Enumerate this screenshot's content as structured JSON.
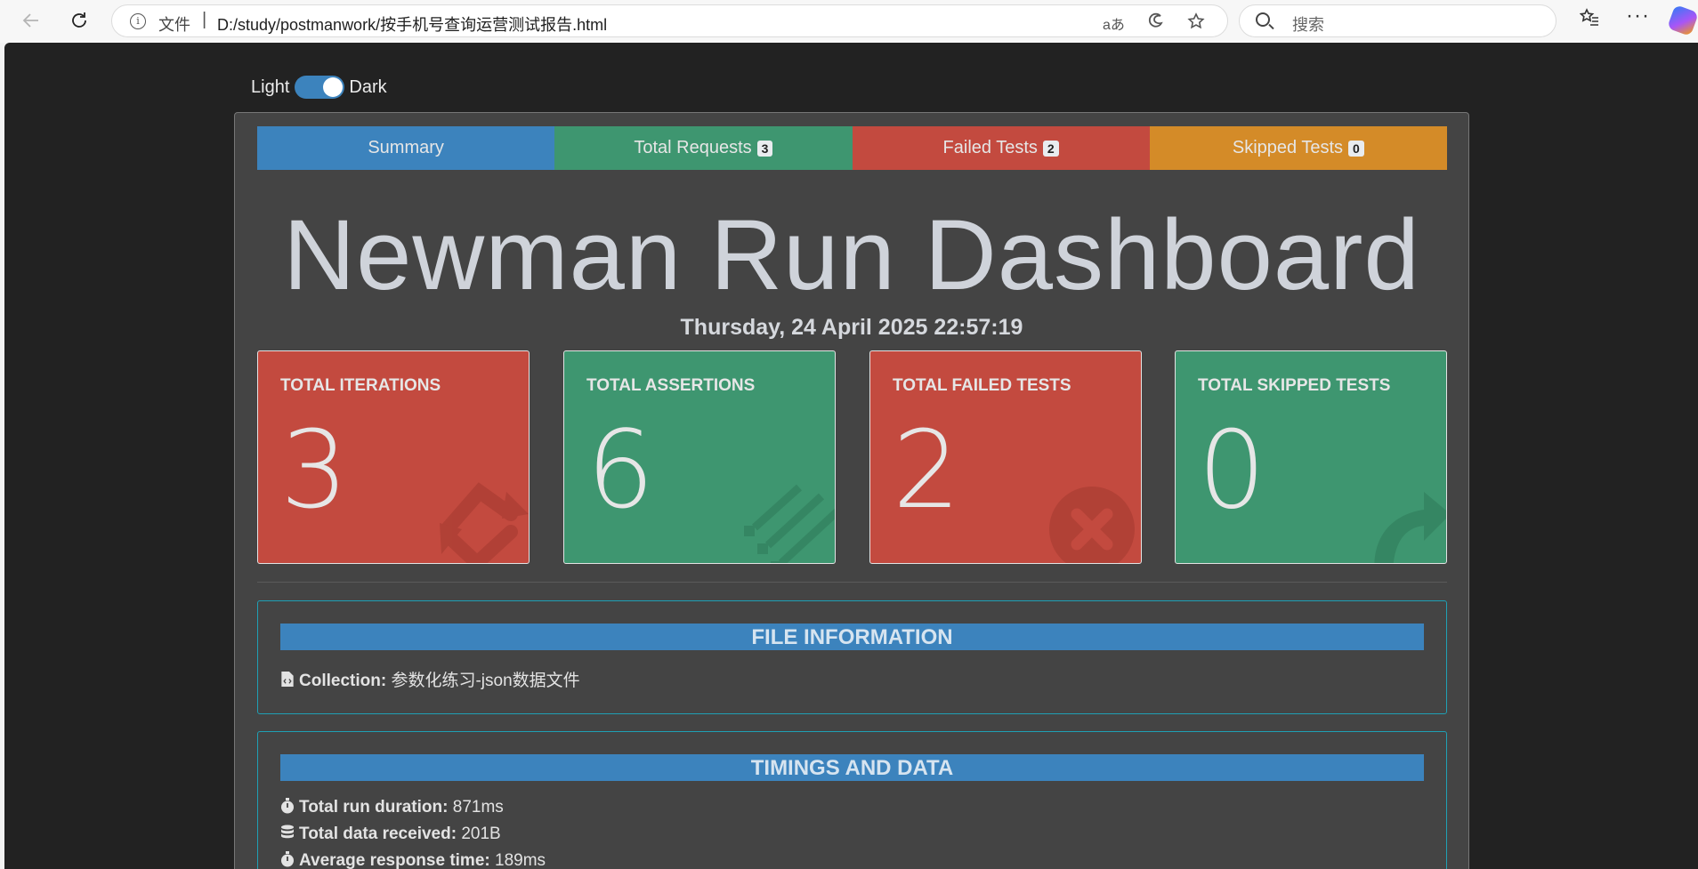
{
  "browser": {
    "address_prefix": "文件",
    "address_url": "D:/study/postmanwork/按手机号查询运营测试报告.html",
    "search_placeholder": "搜索",
    "read_aloud_icon": "aあ"
  },
  "theme_toggle": {
    "light_label": "Light",
    "dark_label": "Dark",
    "state": "dark"
  },
  "tabs": [
    {
      "label": "Summary",
      "badge": null
    },
    {
      "label": "Total Requests",
      "badge": "3"
    },
    {
      "label": "Failed Tests",
      "badge": "2"
    },
    {
      "label": "Skipped Tests",
      "badge": "0"
    }
  ],
  "dashboard": {
    "title": "Newman Run Dashboard",
    "date": "Thursday, 24 April 2025 22:57:19"
  },
  "cards": [
    {
      "label": "TOTAL ITERATIONS",
      "value": "3",
      "icon": "sync-icon",
      "color": "#c34a3f"
    },
    {
      "label": "TOTAL ASSERTIONS",
      "value": "6",
      "icon": "tasks-icon",
      "color": "#3e9670"
    },
    {
      "label": "TOTAL FAILED TESTS",
      "value": "2",
      "icon": "times-circle-icon",
      "color": "#c34a3f"
    },
    {
      "label": "TOTAL SKIPPED TESTS",
      "value": "0",
      "icon": "share-icon",
      "color": "#3e9670"
    }
  ],
  "file_info": {
    "heading": "FILE INFORMATION",
    "collection_label": "Collection:",
    "collection_value": "参数化练习-json数据文件"
  },
  "timings": {
    "heading": "TIMINGS AND DATA",
    "run_duration_label": "Total run duration:",
    "run_duration_value": "871ms",
    "data_received_label": "Total data received:",
    "data_received_value": "201B",
    "avg_response_label": "Average response time:",
    "avg_response_value": "189ms"
  },
  "colors": {
    "page_bg": "#222222",
    "panel_bg": "#444444",
    "primary": "#3c83bd",
    "success": "#3e9670",
    "danger": "#c34a3f",
    "warning": "#d48b28",
    "info_border": "#1fa0b5"
  }
}
